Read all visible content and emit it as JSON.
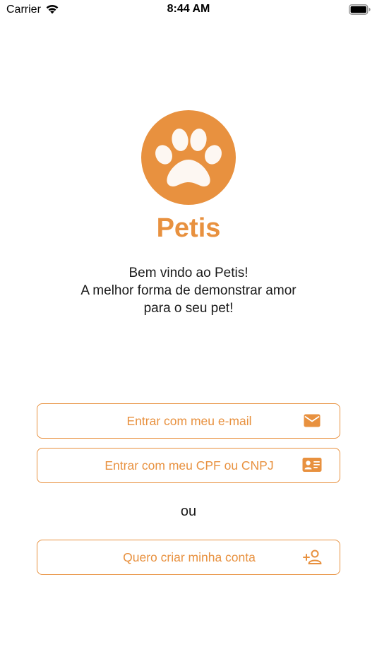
{
  "status_bar": {
    "carrier": "Carrier",
    "time": "8:44 AM",
    "wifi_icon": "wifi-icon",
    "battery_icon": "battery-full-icon"
  },
  "brand": {
    "logo_icon": "paw-icon",
    "name": "Petis",
    "accent_color": "#e8913f"
  },
  "welcome": {
    "line1": "Bem vindo ao Petis!",
    "line2": "A melhor forma de demonstrar amor",
    "line3": "para o seu pet!"
  },
  "actions": {
    "email_login": {
      "label": "Entrar com meu e-mail",
      "icon": "envelope-icon"
    },
    "document_login": {
      "label": "Entrar com meu CPF ou CNPJ",
      "icon": "id-card-icon"
    },
    "separator": "ou",
    "create_account": {
      "label": "Quero criar minha conta",
      "icon": "add-user-icon"
    }
  }
}
